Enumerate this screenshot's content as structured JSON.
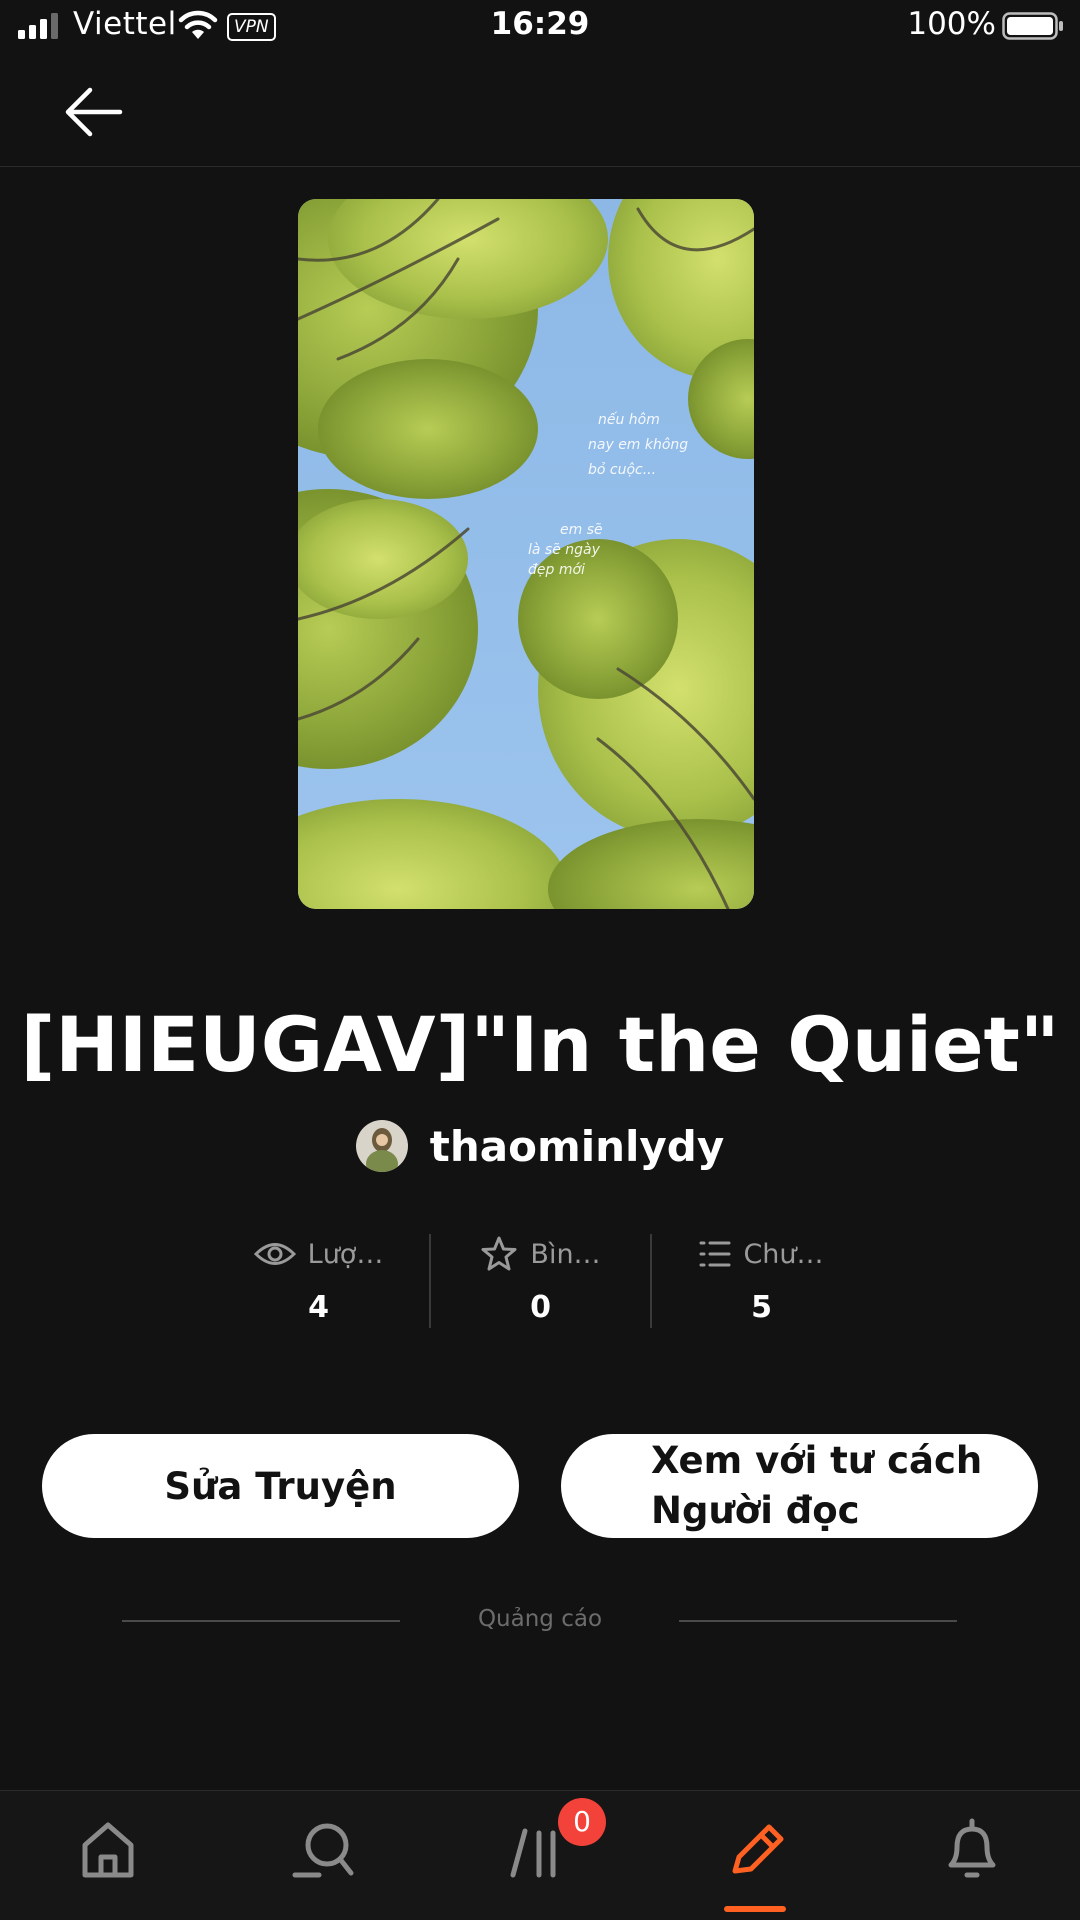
{
  "status_bar": {
    "carrier": "Viettel",
    "vpn": "VPN",
    "time": "16:29",
    "battery_percent": "100%"
  },
  "story": {
    "title": "[HIEUGAV]\"In the Quiet\"",
    "author": "thaominlydy",
    "cover_caption": [
      "nếu hôm",
      "nay em không",
      "bỏ cuộc...",
      "em sẽ",
      "là sẽ ngày",
      "đẹp mới"
    ]
  },
  "stats": [
    {
      "label": "Lượ…",
      "value": "4",
      "icon": "eye-icon"
    },
    {
      "label": "Bìn…",
      "value": "0",
      "icon": "star-icon"
    },
    {
      "label": "Chư…",
      "value": "5",
      "icon": "list-icon"
    }
  ],
  "actions": {
    "edit_label": "Sửa Truyện",
    "preview_line1": "Xem với tư cách",
    "preview_line2": "Người đọc"
  },
  "ad": {
    "label": "Quảng cáo"
  },
  "bottom_nav": {
    "items": [
      {
        "icon": "home-icon",
        "active": false
      },
      {
        "icon": "search-icon",
        "active": false
      },
      {
        "icon": "library-icon",
        "active": false
      },
      {
        "icon": "pencil-icon",
        "active": true
      },
      {
        "icon": "bell-icon",
        "active": false
      }
    ],
    "library_badge": "0"
  },
  "colors": {
    "background": "#121212",
    "accent": "#ff6122",
    "badge": "#f2423a",
    "muted_text": "#9a9a9a"
  }
}
